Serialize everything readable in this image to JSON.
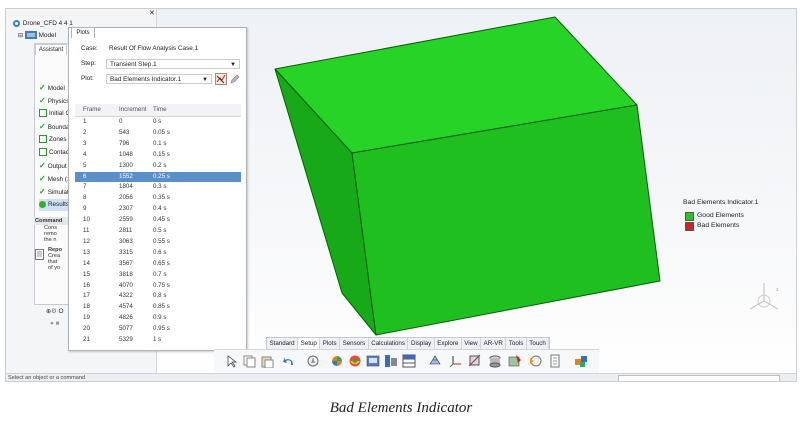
{
  "tree": {
    "root_label": "Drone_CFD 4 4 1",
    "model_label": "Model",
    "bottom_items": [
      "M",
      "O"
    ]
  },
  "assistant": {
    "tab_label": "Assistant",
    "steps": [
      {
        "label": "Model",
        "state": "done"
      },
      {
        "label": "Physics",
        "state": "done"
      },
      {
        "label": "Initial Co",
        "state": "empty"
      },
      {
        "label": "Boundar",
        "state": "done"
      },
      {
        "label": "Zones a",
        "state": "empty"
      },
      {
        "label": "Contacts",
        "state": "empty"
      },
      {
        "label": "Output I",
        "state": "done"
      },
      {
        "label": "Mesh (1",
        "state": "done"
      },
      {
        "label": "Simulati",
        "state": "done"
      },
      {
        "label": "Results",
        "state": "active"
      }
    ],
    "command_title": "Command",
    "command_lines": [
      "Cons",
      "remo",
      "the n"
    ],
    "report_title": "Repo",
    "report_lines": [
      "Crea",
      "that",
      "of yo"
    ]
  },
  "plots": {
    "tab_label": "Plots",
    "case_label": "Case:",
    "case_value": "Result Of Flow Analysis Case.1",
    "step_label": "Step:",
    "step_value": "Transient Step.1",
    "plot_label": "Plot:",
    "plot_value": "Bad Elements Indicator.1",
    "columns": [
      "Frame",
      "Increment",
      "Time"
    ],
    "selected_frame": "6",
    "rows": [
      [
        "1",
        "0",
        "0 s"
      ],
      [
        "2",
        "543",
        "0.05 s"
      ],
      [
        "3",
        "796",
        "0.1 s"
      ],
      [
        "4",
        "1048",
        "0.15 s"
      ],
      [
        "5",
        "1300",
        "0.2 s"
      ],
      [
        "6",
        "1552",
        "0.25 s"
      ],
      [
        "7",
        "1804",
        "0.3 s"
      ],
      [
        "8",
        "2056",
        "0.35 s"
      ],
      [
        "9",
        "2307",
        "0.4 s"
      ],
      [
        "10",
        "2559",
        "0.45 s"
      ],
      [
        "11",
        "2811",
        "0.5 s"
      ],
      [
        "12",
        "3063",
        "0.55 s"
      ],
      [
        "13",
        "3315",
        "0.6 s"
      ],
      [
        "14",
        "3567",
        "0.65 s"
      ],
      [
        "15",
        "3818",
        "0.7 s"
      ],
      [
        "16",
        "4070",
        "0.75 s"
      ],
      [
        "17",
        "4322",
        "0.8 s"
      ],
      [
        "18",
        "4574",
        "0.85 s"
      ],
      [
        "19",
        "4826",
        "0.9 s"
      ],
      [
        "20",
        "5077",
        "0.95 s"
      ],
      [
        "21",
        "5329",
        "1 s"
      ]
    ]
  },
  "legend": {
    "title": "Bad Elements Indicator.1",
    "items": [
      {
        "label": "Good Elements",
        "color": "#2fc02f"
      },
      {
        "label": "Bad Elements",
        "color": "#c62828"
      }
    ]
  },
  "model_colors": {
    "front": "#1fbf1f",
    "top": "#27d327",
    "side": "#17a917",
    "edge": "#0b5e0b"
  },
  "toolbar": {
    "tabs": [
      "Standard",
      "Setup",
      "Plots",
      "Sensors",
      "Calculations",
      "Display",
      "Explore",
      "View",
      "AR-VR",
      "Tools",
      "Touch"
    ],
    "active_tab": "Setup"
  },
  "status": {
    "text": "Select an object or a command"
  },
  "caption": "Bad Elements Indicator"
}
